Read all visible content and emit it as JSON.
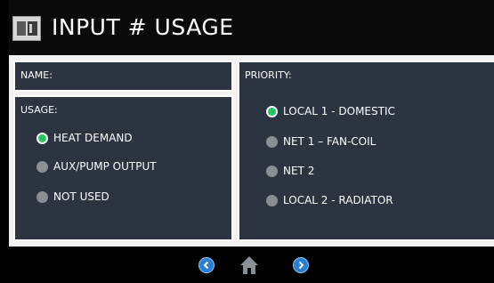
{
  "header": {
    "title": "INPUT # USAGE",
    "icon": "input-module-icon"
  },
  "name_panel": {
    "label": "NAME:"
  },
  "usage_panel": {
    "label": "USAGE:",
    "options": [
      {
        "label": "HEAT DEMAND",
        "selected": true
      },
      {
        "label": "AUX/PUMP OUTPUT",
        "selected": false
      },
      {
        "label": "NOT USED",
        "selected": false
      }
    ]
  },
  "priority_panel": {
    "label": "PRIORITY:",
    "options": [
      {
        "label": "LOCAL 1 - DOMESTIC",
        "selected": true
      },
      {
        "label": "NET 1 – FAN-COIL",
        "selected": false
      },
      {
        "label": "NET 2",
        "selected": false
      },
      {
        "label": "LOCAL 2 - RADIATOR",
        "selected": false
      }
    ]
  },
  "footer": {
    "prev": "chevron-left-icon",
    "home": "home-icon",
    "next": "chevron-right-icon"
  },
  "colors": {
    "panel_bg": "#2b3440",
    "selected_radio": "#22c55e",
    "unselected_radio": "#8a8f96",
    "nav_button": "#2a7fd0"
  }
}
